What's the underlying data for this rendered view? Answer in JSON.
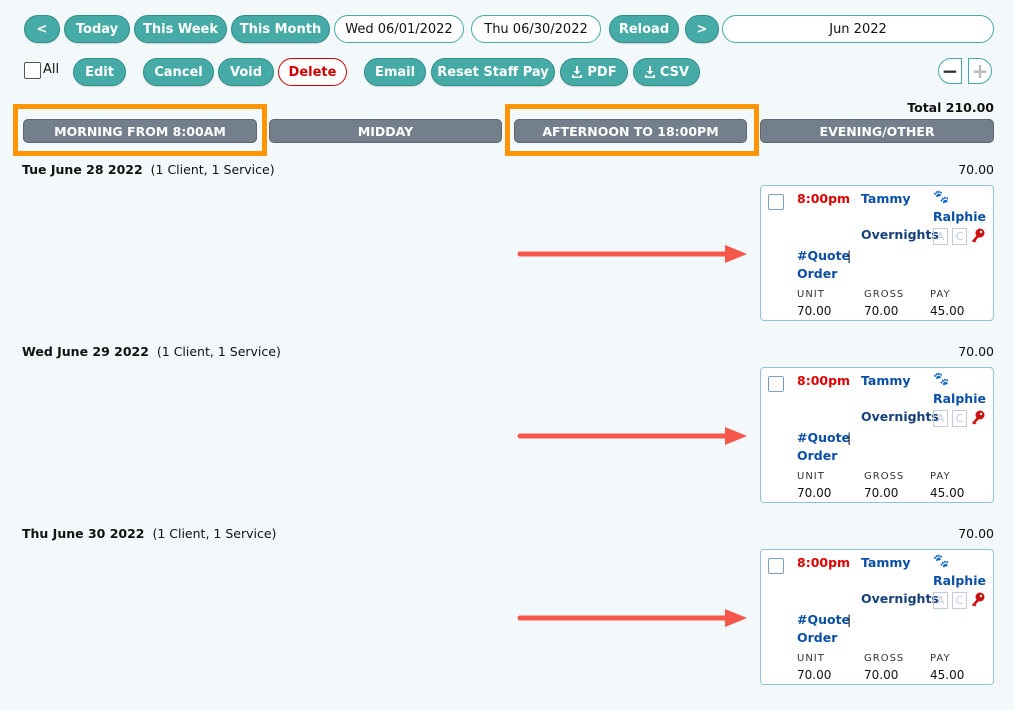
{
  "toolbar": {
    "prev_label": "<",
    "today_label": "Today",
    "this_week_label": "This Week",
    "this_month_label": "This Month",
    "start_date": "Wed 06/01/2022",
    "end_date": "Thu 06/30/2022",
    "reload_label": "Reload",
    "next_label": ">",
    "period_display": "Jun 2022"
  },
  "actions": {
    "all_label": "All",
    "edit_label": "Edit",
    "cancel_label": "Cancel",
    "void_label": "Void",
    "delete_label": "Delete",
    "email_label": "Email",
    "reset_staff_pay_label": "Reset Staff Pay",
    "pdf_label": "PDF",
    "csv_label": "CSV",
    "zoom_out_label": "−",
    "zoom_in_label": "+"
  },
  "total_label": "Total 210.00",
  "periods": [
    {
      "label": "MORNING FROM 8:00AM",
      "highlighted": true
    },
    {
      "label": "MIDDAY",
      "highlighted": false
    },
    {
      "label": "AFTERNOON TO 18:00PM",
      "highlighted": true
    },
    {
      "label": "EVENING/OTHER",
      "highlighted": false
    }
  ],
  "days": [
    {
      "date": "Tue June 28 2022",
      "summary": "(1 Client, 1 Service)",
      "total": "70.00",
      "visit": {
        "time": "8:00pm",
        "staff": "Tammy",
        "pet": "Ralphie",
        "service": "Overnights",
        "tag_a": "A",
        "tag_c": "C",
        "quote": "#Quote",
        "separator": "|",
        "order": "Order",
        "unit_label": "UNIT",
        "gross_label": "GROSS",
        "pay_label": "PAY",
        "unit": "70.00",
        "gross": "70.00",
        "pay": "45.00"
      }
    },
    {
      "date": "Wed June 29 2022",
      "summary": "(1 Client, 1 Service)",
      "total": "70.00",
      "visit": {
        "time": "8:00pm",
        "staff": "Tammy",
        "pet": "Ralphie",
        "service": "Overnights",
        "tag_a": "A",
        "tag_c": "C",
        "quote": "#Quote",
        "separator": "|",
        "order": "Order",
        "unit_label": "UNIT",
        "gross_label": "GROSS",
        "pay_label": "PAY",
        "unit": "70.00",
        "gross": "70.00",
        "pay": "45.00"
      }
    },
    {
      "date": "Thu June 30 2022",
      "summary": "(1 Client, 1 Service)",
      "total": "70.00",
      "visit": {
        "time": "8:00pm",
        "staff": "Tammy",
        "pet": "Ralphie",
        "service": "Overnights",
        "tag_a": "A",
        "tag_c": "C",
        "quote": "#Quote",
        "separator": "|",
        "order": "Order",
        "unit_label": "UNIT",
        "gross_label": "GROSS",
        "pay_label": "PAY",
        "unit": "70.00",
        "gross": "70.00",
        "pay": "45.00"
      }
    }
  ],
  "colors": {
    "teal": "#46aba6",
    "annotation_orange": "#ff9500",
    "annotation_arrow": "#f5574a",
    "time_red": "#e00000",
    "link_blue": "#0a4fa5"
  }
}
